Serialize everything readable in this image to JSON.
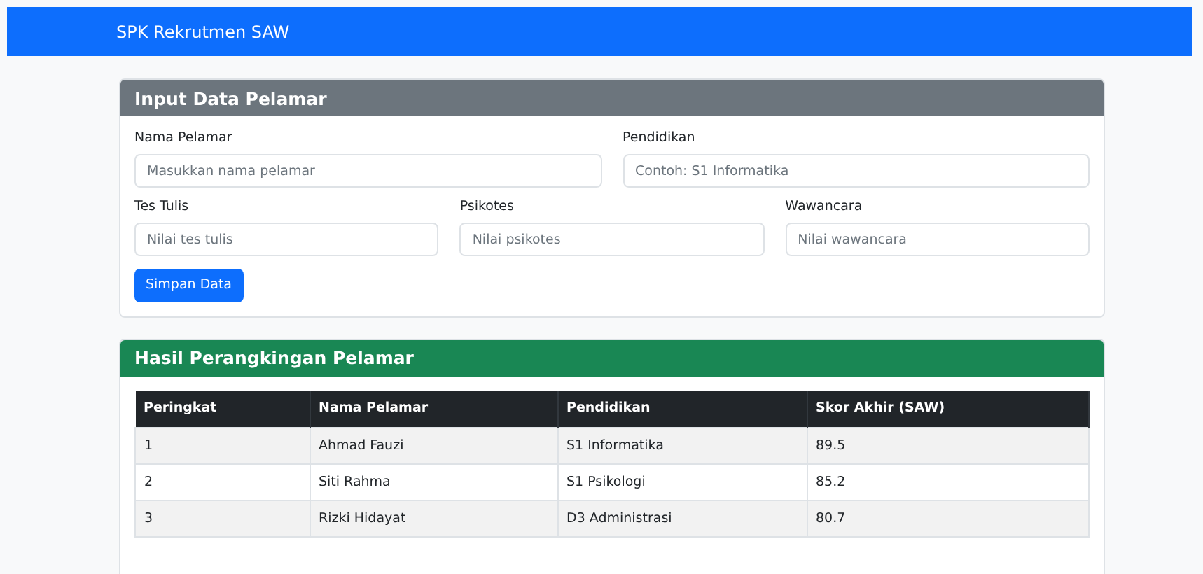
{
  "navbar": {
    "brand": "SPK Rekrutmen SAW"
  },
  "input_card": {
    "title": "Input Data Pelamar",
    "row_1": [
      {
        "label": "Nama Pelamar",
        "placeholder": "Masukkan nama pelamar"
      },
      {
        "label": "Pendidikan",
        "placeholder": "Contoh: S1 Informatika"
      }
    ],
    "row_2": [
      {
        "label": "Tes Tulis",
        "placeholder": "Nilai tes tulis"
      },
      {
        "label": "Psikotes",
        "placeholder": "Nilai psikotes"
      },
      {
        "label": "Wawancara",
        "placeholder": "Nilai wawancara"
      }
    ],
    "button": "Simpan Data"
  },
  "result_card": {
    "title": "Hasil Perangkingan Pelamar",
    "table": {
      "columns": [
        "Peringkat",
        "Nama Pelamar",
        "Pendidikan",
        "Skor Akhir (SAW)"
      ],
      "rows": [
        [
          "1",
          "Ahmad Fauzi",
          "S1 Informatika",
          "89.5"
        ],
        [
          "2",
          "Siti Rahma",
          "S1 Psikologi",
          "85.2"
        ],
        [
          "3",
          "Rizki Hidayat",
          "D3 Administrasi",
          "80.7"
        ]
      ]
    }
  }
}
